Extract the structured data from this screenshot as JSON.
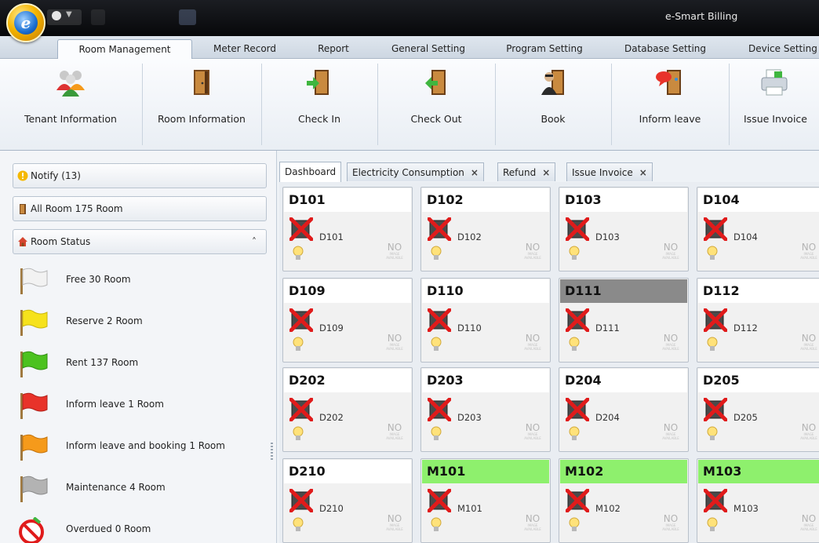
{
  "window": {
    "app_title": "e-Smart Billing"
  },
  "ribbon_tabs": [
    {
      "label": "Room Management",
      "active": true
    },
    {
      "label": "Meter Record"
    },
    {
      "label": "Report"
    },
    {
      "label": "General Setting"
    },
    {
      "label": "Program Setting"
    },
    {
      "label": "Database Setting"
    },
    {
      "label": "Device Setting"
    }
  ],
  "ribbon_buttons": [
    {
      "label": "Tenant Information",
      "icon": "tenant-group-icon"
    },
    {
      "label": "Room Information",
      "icon": "door-icon"
    },
    {
      "label": "Check In",
      "icon": "door-arrow-in-icon"
    },
    {
      "label": "Check Out",
      "icon": "door-arrow-out-icon"
    },
    {
      "label": "Book",
      "icon": "person-at-door-icon"
    },
    {
      "label": "Inform leave",
      "icon": "door-speech-icon"
    },
    {
      "label": "Issue Invoice",
      "icon": "printer-icon"
    }
  ],
  "sidebar": {
    "notify": "Notify (13)",
    "all_room": "All Room 175 Room",
    "room_status_title": "Room Status",
    "statuses": [
      {
        "label": "Free 30 Room",
        "color": "#f2f2f2",
        "icon": "white-flag-icon"
      },
      {
        "label": "Reserve 2 Room",
        "color": "#f6e21c",
        "icon": "yellow-flag-icon"
      },
      {
        "label": "Rent 137 Room",
        "color": "#4cc21f",
        "icon": "green-flag-icon"
      },
      {
        "label": "Inform leave 1 Room",
        "color": "#e8332a",
        "icon": "red-flag-icon"
      },
      {
        "label": "Inform leave and booking 1 Room",
        "color": "#f59a1b",
        "icon": "orange-flag-icon"
      },
      {
        "label": "Maintenance 4 Room",
        "color": "#a9a9a9",
        "icon": "gray-flag-icon"
      },
      {
        "label": "Overdued 0 Room",
        "color": "#e01b1b",
        "icon": "overdue-prohibited-icon"
      }
    ]
  },
  "doc_tabs": [
    {
      "label": "Dashboard",
      "active": true,
      "closable": false
    },
    {
      "label": "Electricity Consumption",
      "closable": true,
      "close": "×"
    },
    {
      "label": "Refund",
      "closable": true,
      "close": "×"
    },
    {
      "label": "Issue Invoice",
      "closable": true,
      "close": "×"
    }
  ],
  "status_colors": {
    "rent": "#8ef06d",
    "maintenance": "#8a8a8a",
    "default": "#ffffff"
  },
  "no_image_text": "NO",
  "no_image_small": "IMAGE AVAILABLE",
  "rooms": [
    {
      "name": "D101",
      "code": "D101",
      "status": "default"
    },
    {
      "name": "D102",
      "code": "D102",
      "status": "default"
    },
    {
      "name": "D103",
      "code": "D103",
      "status": "default"
    },
    {
      "name": "D104",
      "code": "D104",
      "status": "default"
    },
    {
      "name": "D109",
      "code": "D109",
      "status": "default"
    },
    {
      "name": "D110",
      "code": "D110",
      "status": "default"
    },
    {
      "name": "D111",
      "code": "D111",
      "status": "maintenance"
    },
    {
      "name": "D112",
      "code": "D112",
      "status": "default"
    },
    {
      "name": "D202",
      "code": "D202",
      "status": "default"
    },
    {
      "name": "D203",
      "code": "D203",
      "status": "default"
    },
    {
      "name": "D204",
      "code": "D204",
      "status": "default"
    },
    {
      "name": "D205",
      "code": "D205",
      "status": "default"
    },
    {
      "name": "D210",
      "code": "D210",
      "status": "default"
    },
    {
      "name": "M101",
      "code": "M101",
      "status": "rent"
    },
    {
      "name": "M102",
      "code": "M102",
      "status": "rent"
    },
    {
      "name": "M103",
      "code": "M103",
      "status": "rent"
    }
  ]
}
